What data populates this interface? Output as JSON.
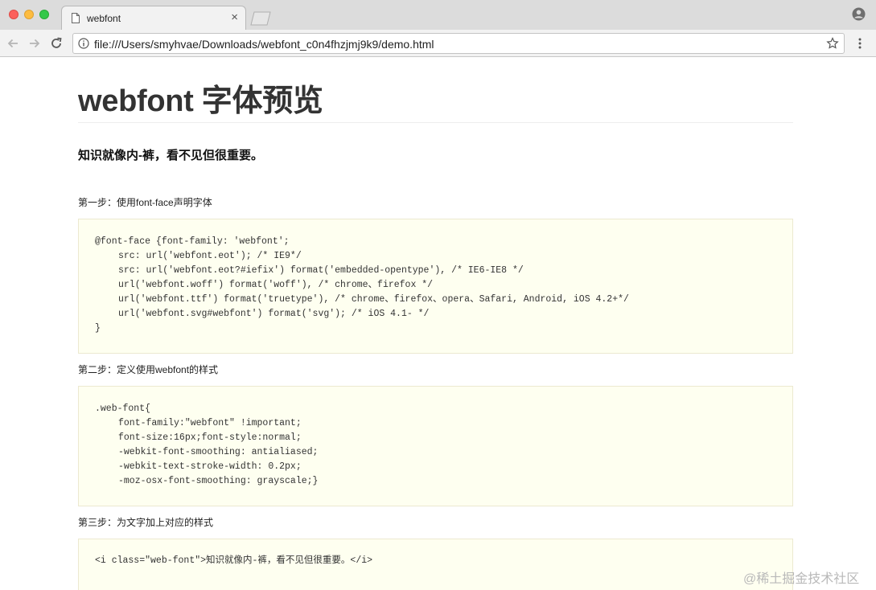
{
  "browser": {
    "tab_title": "webfont",
    "tab_close": "×",
    "url": "file:///Users/smyhvae/Downloads/webfont_c0n4fhzjmj9k9/demo.html"
  },
  "page": {
    "title": "webfont 字体预览",
    "subtitle": "知识就像内-裤，看不见但很重要。",
    "steps": [
      {
        "label": "第一步：使用font-face声明字体",
        "code": [
          "@font-face {font-family: 'webfont';",
          "src: url('webfont.eot'); /* IE9*/",
          "src: url('webfont.eot?#iefix') format('embedded-opentype'), /* IE6-IE8 */",
          "url('webfont.woff') format('woff'), /* chrome、firefox */",
          "url('webfont.ttf') format('truetype'), /* chrome、firefox、opera、Safari, Android, iOS 4.2+*/",
          "url('webfont.svg#webfont') format('svg'); /* iOS 4.1- */",
          "}"
        ]
      },
      {
        "label": "第二步：定义使用webfont的样式",
        "code": [
          ".web-font{",
          "font-family:\"webfont\" !important;",
          "font-size:16px;font-style:normal;",
          "-webkit-font-smoothing: antialiased;",
          "-webkit-text-stroke-width: 0.2px;",
          "-moz-osx-font-smoothing: grayscale;}"
        ]
      },
      {
        "label": "第三步：为文字加上对应的样式",
        "code": [
          "<i class=\"web-font\">知识就像内-裤，看不见但很重要。</i>"
        ]
      }
    ]
  },
  "watermark": "@稀土掘金技术社区"
}
